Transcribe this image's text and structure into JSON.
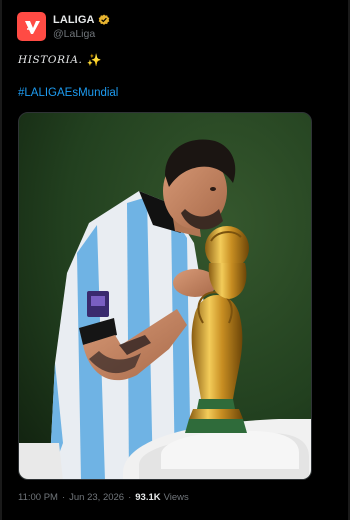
{
  "account": {
    "display_name": "LALIGA",
    "handle": "@LaLiga",
    "avatar_icon": "laliga-logo-icon",
    "avatar_color": "#ff4b44",
    "verified_icon": "verified-badge-icon",
    "verified_color": "#e8b430"
  },
  "tweet": {
    "text": "HISTORIA.",
    "emoji": "✨",
    "hashtag": "#LALIGAEsMundial",
    "media_alt": "Player in striped jersey kissing the World Cup trophy"
  },
  "meta": {
    "time": "11:00 PM",
    "separator": "·",
    "date": "Jun 23, 2026",
    "views_count": "93.1K",
    "views_label": "Views"
  },
  "colors": {
    "background": "#000000",
    "text": "#e7e9ea",
    "muted": "#71767b",
    "link": "#1d9bf0"
  }
}
